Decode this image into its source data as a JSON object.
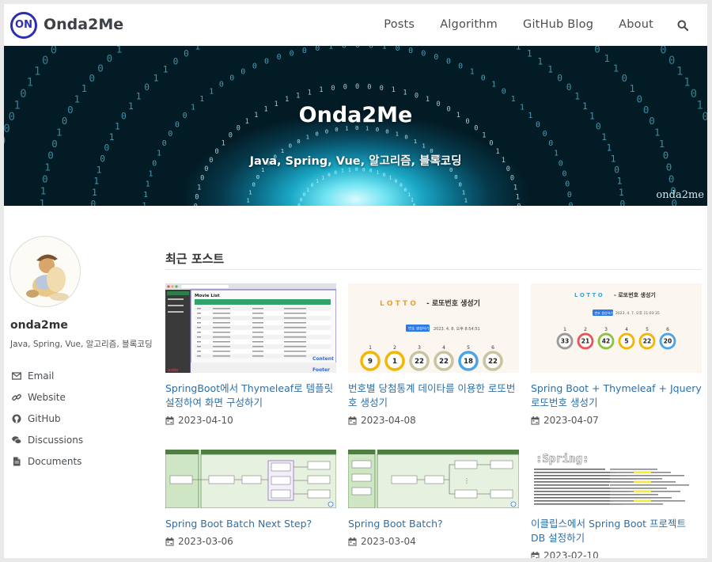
{
  "site": {
    "logo_text": "ON",
    "title": "Onda2Me"
  },
  "nav": {
    "items": [
      "Posts",
      "Algorithm",
      "GitHub Blog",
      "About"
    ]
  },
  "hero": {
    "title": "Onda2Me",
    "subtitle": "Java, Spring, Vue, 알고리즘, 블록코딩",
    "credit": "onda2me"
  },
  "author": {
    "name": "onda2me",
    "bio": "Java, Spring, Vue, 알고리즘, 블록코딩",
    "links": [
      {
        "label": "Email",
        "icon": "envelope-icon"
      },
      {
        "label": "Website",
        "icon": "link-icon"
      },
      {
        "label": "GitHub",
        "icon": "github-icon"
      },
      {
        "label": "Discussions",
        "icon": "comments-icon"
      },
      {
        "label": "Documents",
        "icon": "file-icon"
      }
    ]
  },
  "main": {
    "section_title": "최근 포스트",
    "posts": [
      {
        "title": "SpringBoot에서 Thymeleaf로 템플릿 설정하여 화면 구성하기",
        "date": "2023-04-10"
      },
      {
        "title": "번호별 당첨통계 데이타를 이용한 로또번호 생성기",
        "date": "2023-04-08"
      },
      {
        "title": "Spring Boot + Thymeleaf + Jquery 로또번호 생성기",
        "date": "2023-04-07"
      },
      {
        "title": "Spring Boot Batch Next Step?",
        "date": "2023-03-06"
      },
      {
        "title": "Spring Boot Batch?",
        "date": "2023-03-04"
      },
      {
        "title": "이클립스에서 Spring Boot 프로젝트 DB 설정하기",
        "date": "2023-02-10"
      }
    ]
  },
  "thumbs": {
    "movie": {
      "list_title": "Movie List",
      "content_label": "Content",
      "footer_label": "Footer",
      "aside_label": "aside"
    },
    "lotto_a": {
      "brand": "L O T T O",
      "title": "- 로또번호 생성기",
      "button": "번호 생성하기",
      "info": "2023. 4. 8. 오후 8:54:51",
      "numbers": [
        "9",
        "1",
        "22",
        "22",
        "18",
        "22"
      ],
      "labels": [
        "1",
        "2",
        "3",
        "4",
        "5",
        "6"
      ]
    },
    "lotto_b": {
      "brand": "L O T T O",
      "title": "- 로또번호 생성기",
      "button": "번호 생성하기",
      "info": "2023. 4. 7. 오후 11:03:35",
      "numbers": [
        "33",
        "21",
        "42",
        "5",
        "22",
        "20"
      ],
      "labels": [
        "1",
        "2",
        "3",
        "4",
        "5",
        "6"
      ]
    }
  },
  "colors": {
    "accent_blue": "#2f6fa6",
    "logo_blue": "#2d2fb0",
    "hero_cyan": "#1aa7c4"
  }
}
